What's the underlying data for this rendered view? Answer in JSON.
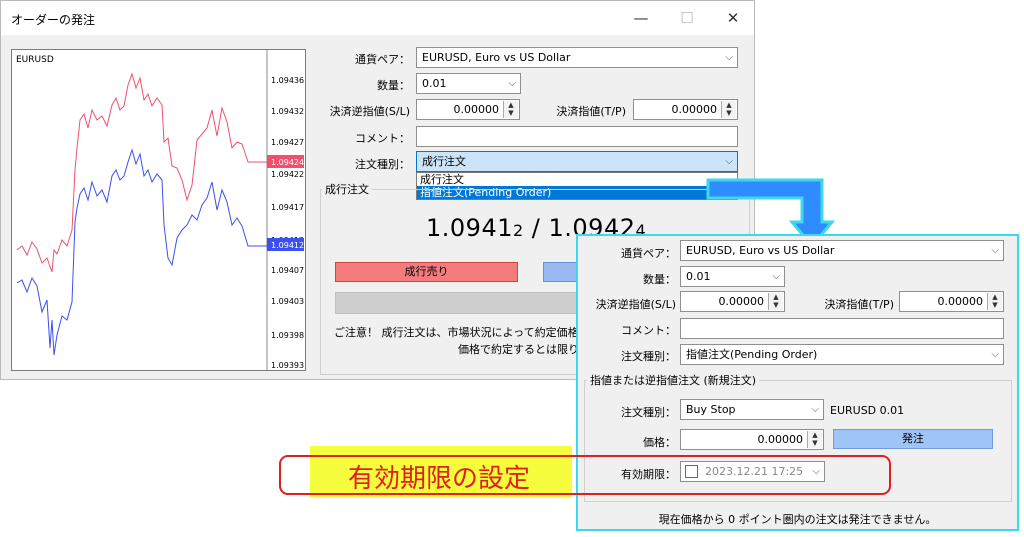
{
  "window": {
    "title": "オーダーの発注",
    "min_symbol": "—",
    "max_symbol": "☐",
    "close_symbol": "✕"
  },
  "chart": {
    "symbol": "EURUSD",
    "price_ticks": [
      "1.09436",
      "1.09432",
      "1.09427",
      "1.09422",
      "1.09417",
      "1.09412",
      "1.09407",
      "1.09403",
      "1.09398",
      "1.09393"
    ],
    "bid_label": "1.09424",
    "ask_label": "1.09412",
    "bid_color": "#f0506e",
    "ask_color": "#3c50f0"
  },
  "form": {
    "pair_label": "通貨ペア：",
    "pair_value": "EURUSD, Euro vs US Dollar",
    "volume_label": "数量：",
    "volume_value": "0.01",
    "sl_label": "決済逆指値(S/L)",
    "sl_value": "0.00000",
    "tp_label": "決済指値(T/P)",
    "tp_value": "0.00000",
    "comment_label": "コメント：",
    "comment_value": "",
    "ordertype_label": "注文種別：",
    "ordertype_value": "成行注文",
    "dropdown_options": [
      "成行注文",
      "指値注文(Pending Order)"
    ]
  },
  "market": {
    "group_title": "成行注文",
    "price_main_1": "1.0941",
    "price_small_1": "2",
    "price_sep": " / ",
    "price_main_2": "1.0942",
    "price_small_2": "4",
    "sell_label": "成行売り",
    "notice_line1": "ご注意！ 成行注文は、市場状況によって約定価格",
    "notice_line2": "価格で約定するとは限りま"
  },
  "popup": {
    "pair_label": "通貨ペア：",
    "pair_value": "EURUSD, Euro vs US Dollar",
    "volume_label": "数量：",
    "volume_value": "0.01",
    "sl_label": "決済逆指値(S/L)",
    "sl_value": "0.00000",
    "tp_label": "決済指値(T/P)",
    "tp_value": "0.00000",
    "comment_label": "コメント：",
    "comment_value": "",
    "ordertype_label": "注文種別：",
    "ordertype_value": "指値注文(Pending Order)",
    "group_title": "指値または逆指値注文 (新規注文)",
    "pending_type_label": "注文種別：",
    "pending_type_value": "Buy Stop",
    "pending_symbol": "EURUSD 0.01",
    "price_label": "価格：",
    "price_value": "0.00000",
    "place_button": "発注",
    "expiry_label": "有効期限：",
    "expiry_value": "2023.12.21 17:25",
    "footer_note": "現在価格から 0 ポイント圏内の注文は発注できません。"
  },
  "annotation": {
    "text": "有効期限の設定",
    "highlight_color": "#f5fd3c",
    "outline_color": "#e02020",
    "arrow_color": "#3ed7ee"
  }
}
